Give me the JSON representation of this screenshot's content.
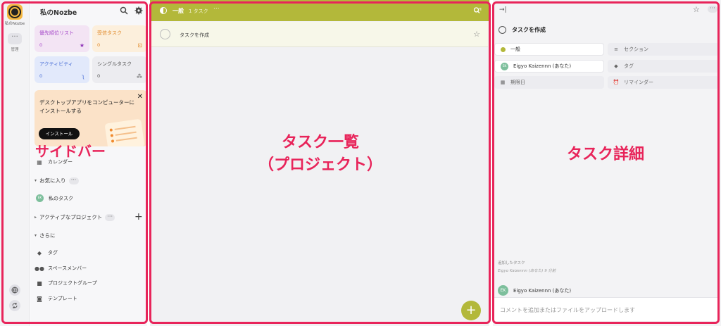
{
  "rail": {
    "app_name": "私のNozbe",
    "more": "···",
    "manage": "管理"
  },
  "sidebar": {
    "title": "私のNozbe",
    "tiles": [
      {
        "label": "優先順位リスト",
        "count": "0",
        "icon": "★"
      },
      {
        "label": "受信タスク",
        "count": "0",
        "icon": "⊡"
      },
      {
        "label": "アクティビティ",
        "count": "0",
        "icon": "ʅ"
      },
      {
        "label": "シングルタスク",
        "count": "0",
        "icon": "⁂"
      }
    ],
    "promo": {
      "text": "デスクトップアプリをコンピューターにインストールする",
      "install_label": "インストール",
      "close": "✕"
    },
    "calendar_label": "カレンダー",
    "favorites_label": "お気に入り",
    "favorites_dots": "···",
    "my_tasks_label": "私のタスク",
    "my_tasks_avatar": "EK",
    "active_projects_label": "アクティブなプロジェクト",
    "active_projects_dots": "···",
    "add": "+",
    "more_label": "さらに",
    "more_items": [
      "タグ",
      "スペースメンバー",
      "プロジェクトグループ",
      "テンプレート"
    ]
  },
  "tasklist": {
    "project_name": "一般",
    "task_count": "1 タスク",
    "dots": "···",
    "new_task_placeholder": "タスクを作成",
    "star": "☆",
    "fab": "+"
  },
  "detail": {
    "collapse": "→|",
    "star": "☆",
    "more": "···",
    "title": "タスクを作成",
    "fields": {
      "project": "一般",
      "section": "セクション",
      "assignee": "Eigyo Kaizennn (あなた)",
      "assignee_avatar": "EK",
      "tag": "タグ",
      "due": "期限日",
      "reminder": "リマインダー"
    },
    "added_label": "追加したタスク",
    "added_by": "Eigyo Kaizennn (あなた) 9 分前",
    "comment_user": "Eigyo Kaizennn (あなた)",
    "comment_avatar": "EK",
    "comment_placeholder": "コメントを追加またはファイルをアップロードします"
  },
  "annotations": {
    "sidebar": "サイドバー",
    "tasklist_line1": "タスク一覧",
    "tasklist_line2": "（プロジェクト）",
    "detail": "タスク詳細"
  },
  "colors": {
    "accent_olive": "#b3b83a",
    "annotation_red": "#e8245a",
    "priority_purple": "#a64ac9",
    "inbox_orange": "#e0892a",
    "activity_blue": "#4a6fd6"
  }
}
